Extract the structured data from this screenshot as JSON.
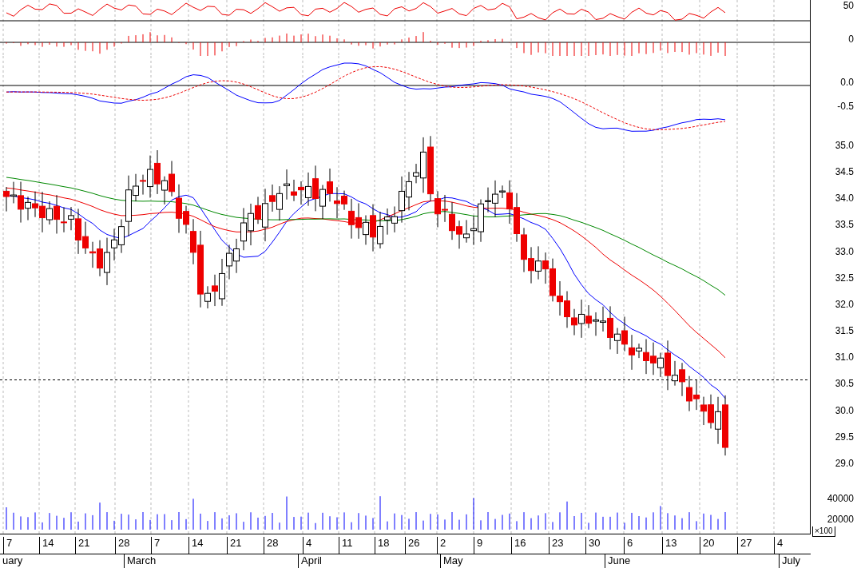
{
  "panels": [
    {
      "kind": "oscillator",
      "ticks": [
        "50"
      ]
    },
    {
      "kind": "histogram",
      "ticks": [
        "0"
      ]
    },
    {
      "kind": "macd",
      "ticks": [
        "0.0",
        "-0.5"
      ]
    },
    {
      "kind": "price",
      "ticks": [
        "35.0",
        "34.5",
        "34.0",
        "33.5",
        "33.0",
        "32.5",
        "32.0",
        "31.5",
        "31.0",
        "30.5",
        "30.0",
        "29.5",
        "29.0"
      ]
    },
    {
      "kind": "volume",
      "ticks": [
        "40000",
        "20000"
      ],
      "unit": "×100"
    }
  ],
  "dates": [
    "7",
    "14",
    "21",
    "28",
    "7",
    "14",
    "21",
    "28",
    "4",
    "11",
    "18",
    "26",
    "2",
    "9",
    "16",
    "23",
    "30",
    "6",
    "13",
    "20",
    "27",
    "4"
  ],
  "months": [
    "uary",
    "March",
    "April",
    "May",
    "June",
    "July"
  ]
}
